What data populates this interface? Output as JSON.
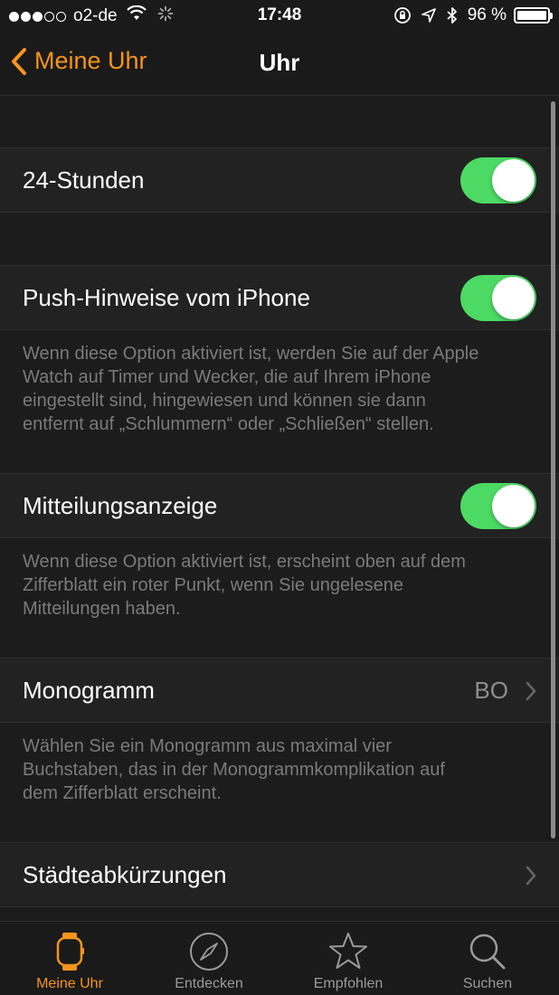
{
  "status_bar": {
    "carrier": "o2-de",
    "time": "17:48",
    "battery": "96 %"
  },
  "nav": {
    "back_label": "Meine Uhr",
    "title": "Uhr"
  },
  "settings": {
    "hours24": {
      "label": "24-Stunden",
      "on": true
    },
    "push": {
      "label": "Push-Hinweise vom iPhone",
      "on": true,
      "footer_lines": [
        "Wenn diese Option aktiviert ist, werden Sie auf der Apple",
        "Watch auf Timer und Wecker, die auf Ihrem iPhone",
        "eingestellt sind, hingewiesen und können sie dann",
        "entfernt auf „Schlummern“ oder „Schließen“ stellen."
      ]
    },
    "notification": {
      "label": "Mitteilungsanzeige",
      "on": true,
      "footer_lines": [
        "Wenn diese Option aktiviert ist, erscheint oben auf dem",
        "Zifferblatt ein roter Punkt, wenn Sie ungelesene",
        "Mitteilungen haben."
      ]
    },
    "monogram": {
      "label": "Monogramm",
      "value": "BO",
      "footer_lines": [
        "Wählen Sie ein Monogramm aus maximal vier",
        "Buchstaben, das in der Monogrammkomplikation auf",
        "dem Zifferblatt erscheint."
      ]
    },
    "city": {
      "label": "Städteabkürzungen"
    }
  },
  "tabs": [
    {
      "label": "Meine Uhr",
      "icon": "watch-icon",
      "active": true
    },
    {
      "label": "Entdecken",
      "icon": "compass-icon",
      "active": false
    },
    {
      "label": "Empfohlen",
      "icon": "star-icon",
      "active": false
    },
    {
      "label": "Suchen",
      "icon": "search-icon",
      "active": false
    }
  ],
  "colors": {
    "accent": "#f7941d",
    "toggle_on": "#4cd964",
    "background": "#1c1c1c",
    "cell": "#222222"
  }
}
